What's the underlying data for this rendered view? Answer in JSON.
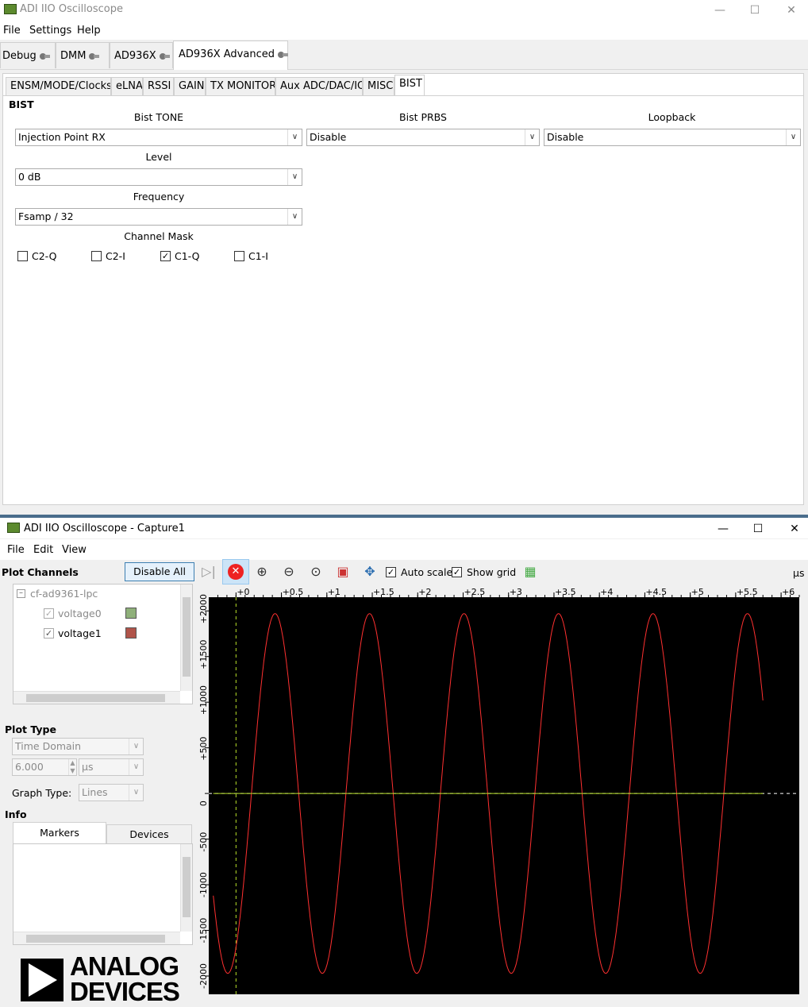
{
  "top_window": {
    "title": "ADI IIO Oscilloscope",
    "menu": [
      "File",
      "Settings",
      "Help"
    ],
    "device_tabs": [
      "Debug",
      "DMM",
      "AD936X",
      "AD936X Advanced"
    ],
    "sub_tabs": [
      "ENSM/MODE/Clocks",
      "eLNA",
      "RSSI",
      "GAIN",
      "TX MONITOR",
      "Aux ADC/DAC/IO",
      "MISC",
      "BIST"
    ],
    "bist": {
      "section_title": "BIST",
      "tone_label": "Bist TONE",
      "tone_value": "Injection Point RX",
      "prbs_label": "Bist PRBS",
      "prbs_value": "Disable",
      "loopback_label": "Loopback",
      "loopback_value": "Disable",
      "level_label": "Level",
      "level_value": "0 dB",
      "frequency_label": "Frequency",
      "frequency_value": "Fsamp / 32",
      "mask_label": "Channel Mask",
      "mask": [
        {
          "label": "C2-Q",
          "checked": false
        },
        {
          "label": "C2-I",
          "checked": false
        },
        {
          "label": "C1-Q",
          "checked": true
        },
        {
          "label": "C1-I",
          "checked": false
        }
      ]
    }
  },
  "capture_window": {
    "title": "ADI IIO Oscilloscope - Capture1",
    "menu": [
      "File",
      "Edit",
      "View"
    ],
    "plot_channels_label": "Plot Channels",
    "disable_all_label": "Disable All",
    "device_name": "cf-ad9361-lpc",
    "channels": [
      {
        "name": "voltage0",
        "enabled": false,
        "color": "#8fb07a"
      },
      {
        "name": "voltage1",
        "enabled": true,
        "color": "#b0544a"
      }
    ],
    "plot_type_label": "Plot Type",
    "plot_type_value": "Time Domain",
    "sample_value": "6.000",
    "sample_unit": "μs",
    "graph_type_label": "Graph Type:",
    "graph_type_value": "Lines",
    "info_label": "Info",
    "info_tabs": [
      "Markers",
      "Devices"
    ],
    "auto_scale_label": "Auto scale",
    "auto_scale_checked": true,
    "show_grid_label": "Show grid",
    "show_grid_checked": true,
    "x_unit": "μs",
    "logo_line1": "ANALOG",
    "logo_line2": "DEVICES"
  },
  "chart_data": {
    "type": "line",
    "x_tick_labels": [
      "+0",
      "+0.5",
      "+1",
      "+1.5",
      "+2",
      "+2.5",
      "+3",
      "+3.5",
      "+4",
      "+4.5",
      "+5",
      "+5.5",
      "+6"
    ],
    "y_tick_labels": [
      "+2000",
      "+1500",
      "+1000",
      "+500",
      "0",
      "-500",
      "-1000",
      "-1500",
      "-2000"
    ],
    "xlim": [
      -0.3,
      6.2
    ],
    "ylim": [
      -2200,
      2150
    ],
    "series": [
      {
        "color": "#ff3030",
        "amplitude": 1970,
        "period_us": 1.04,
        "phase_peak_us": 0.43,
        "x_end_us": 5.8
      },
      {
        "color": "#b8e02a",
        "amplitude": 0,
        "x_end_us": 5.8
      }
    ]
  }
}
